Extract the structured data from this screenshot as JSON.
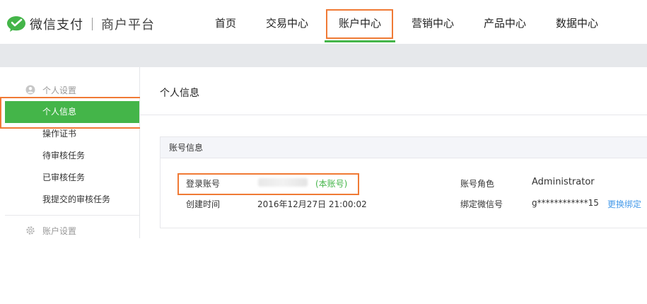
{
  "brand": {
    "name": "微信支付",
    "platform": "商户平台",
    "accent": "#44b549"
  },
  "nav": [
    {
      "label": "首页"
    },
    {
      "label": "交易中心"
    },
    {
      "label": "账户中心",
      "active": true
    },
    {
      "label": "营销中心"
    },
    {
      "label": "产品中心"
    },
    {
      "label": "数据中心"
    }
  ],
  "sidebar": {
    "group1": {
      "label": "个人设置",
      "icon": "user-icon"
    },
    "items": [
      {
        "label": "个人信息",
        "active": true
      },
      {
        "label": "操作证书"
      },
      {
        "label": "待审核任务"
      },
      {
        "label": "已审核任务"
      },
      {
        "label": "我提交的审核任务"
      }
    ],
    "group2": {
      "label": "账户设置",
      "icon": "gear-icon"
    }
  },
  "main": {
    "title": "个人信息",
    "card": {
      "header": "账号信息",
      "login_label": "登录账号",
      "login_note": "(本账号)",
      "created_label": "创建时间",
      "created_value": "2016年12月27日 21:00:02",
      "role_label": "账号角色",
      "role_value": "Administrator",
      "wechat_label": "绑定微信号",
      "wechat_value": "g************15",
      "rebind_link": "更换绑定"
    }
  },
  "highlight_color": "#f07a35"
}
